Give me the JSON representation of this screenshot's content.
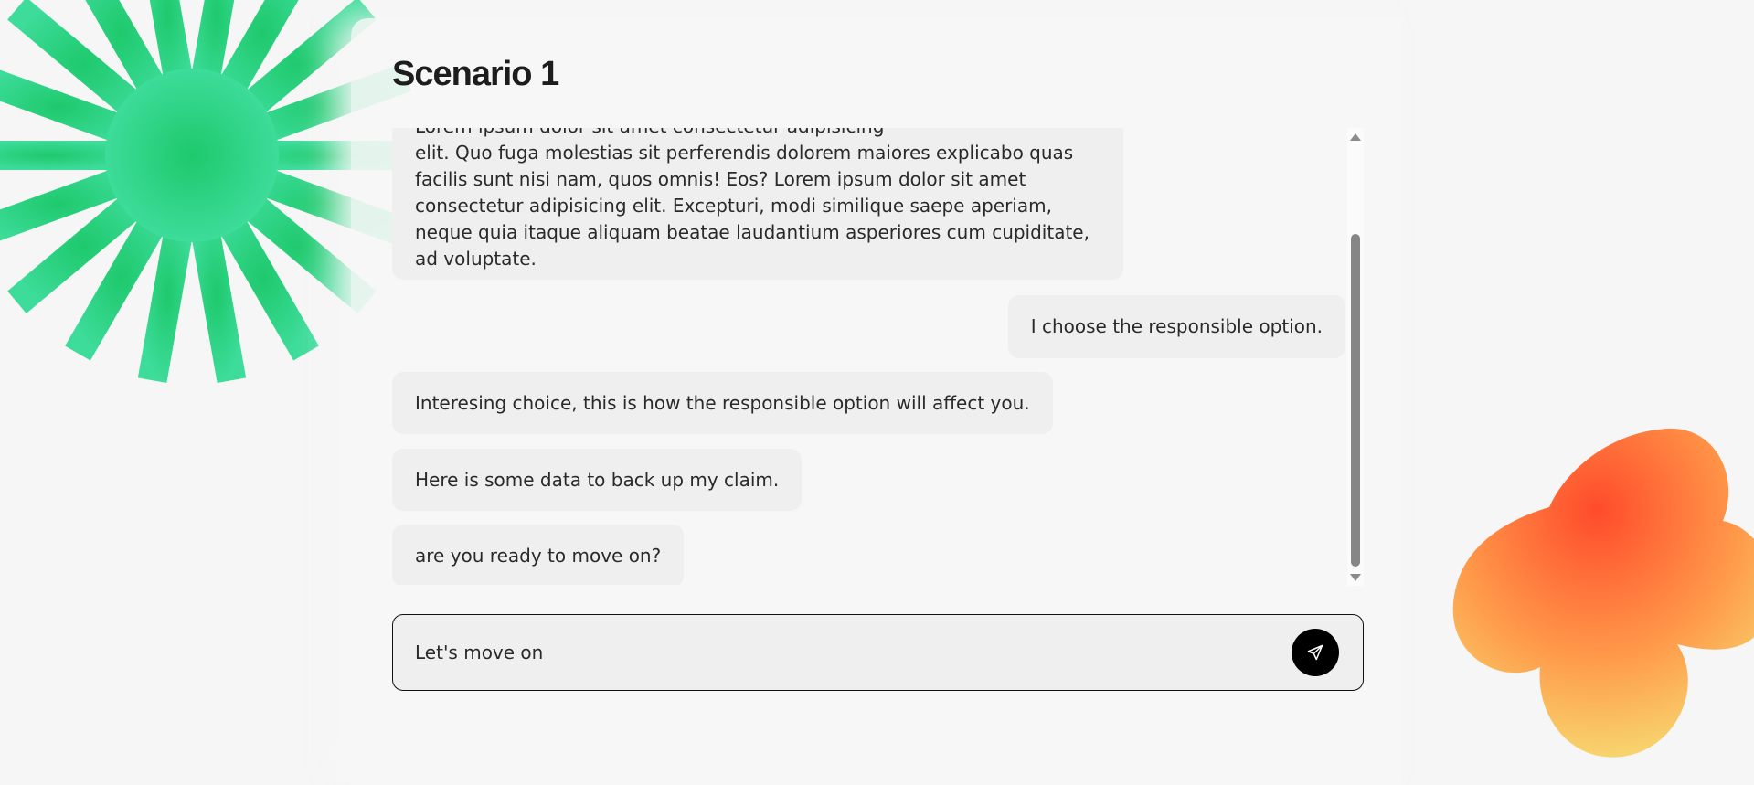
{
  "page": {
    "title": "Scenario 1"
  },
  "chat": {
    "messages": [
      {
        "role": "bot",
        "lines": [
          "Lorem ipsum dolor sit amet consectetur adipisicing",
          "elit. Quo fuga molestias sit perferendis dolorem maiores explicabo quas",
          "facilis sunt nisi nam, quos omnis! Eos? Lorem ipsum dolor sit amet",
          "consectetur adipisicing elit. Excepturi, modi similique saepe aperiam,",
          "neque quia itaque aliquam beatae laudantium asperiores cum cupiditate,",
          "ad voluptate."
        ]
      },
      {
        "role": "user",
        "text": "I choose the responsible option."
      },
      {
        "role": "bot",
        "text": "Interesing choice, this is how the responsible option will affect you."
      },
      {
        "role": "bot",
        "text": "Here is some data to back up my claim."
      },
      {
        "role": "bot",
        "text": "are you ready to move on?"
      }
    ]
  },
  "composer": {
    "value": "Let's move on",
    "send_icon": "paper-plane-icon"
  },
  "colors": {
    "background": "#f6f6f6",
    "bubble": "#efefef",
    "accent_green": "#22c56a",
    "accent_orange": "#ff6a3d",
    "send_button": "#000000"
  }
}
